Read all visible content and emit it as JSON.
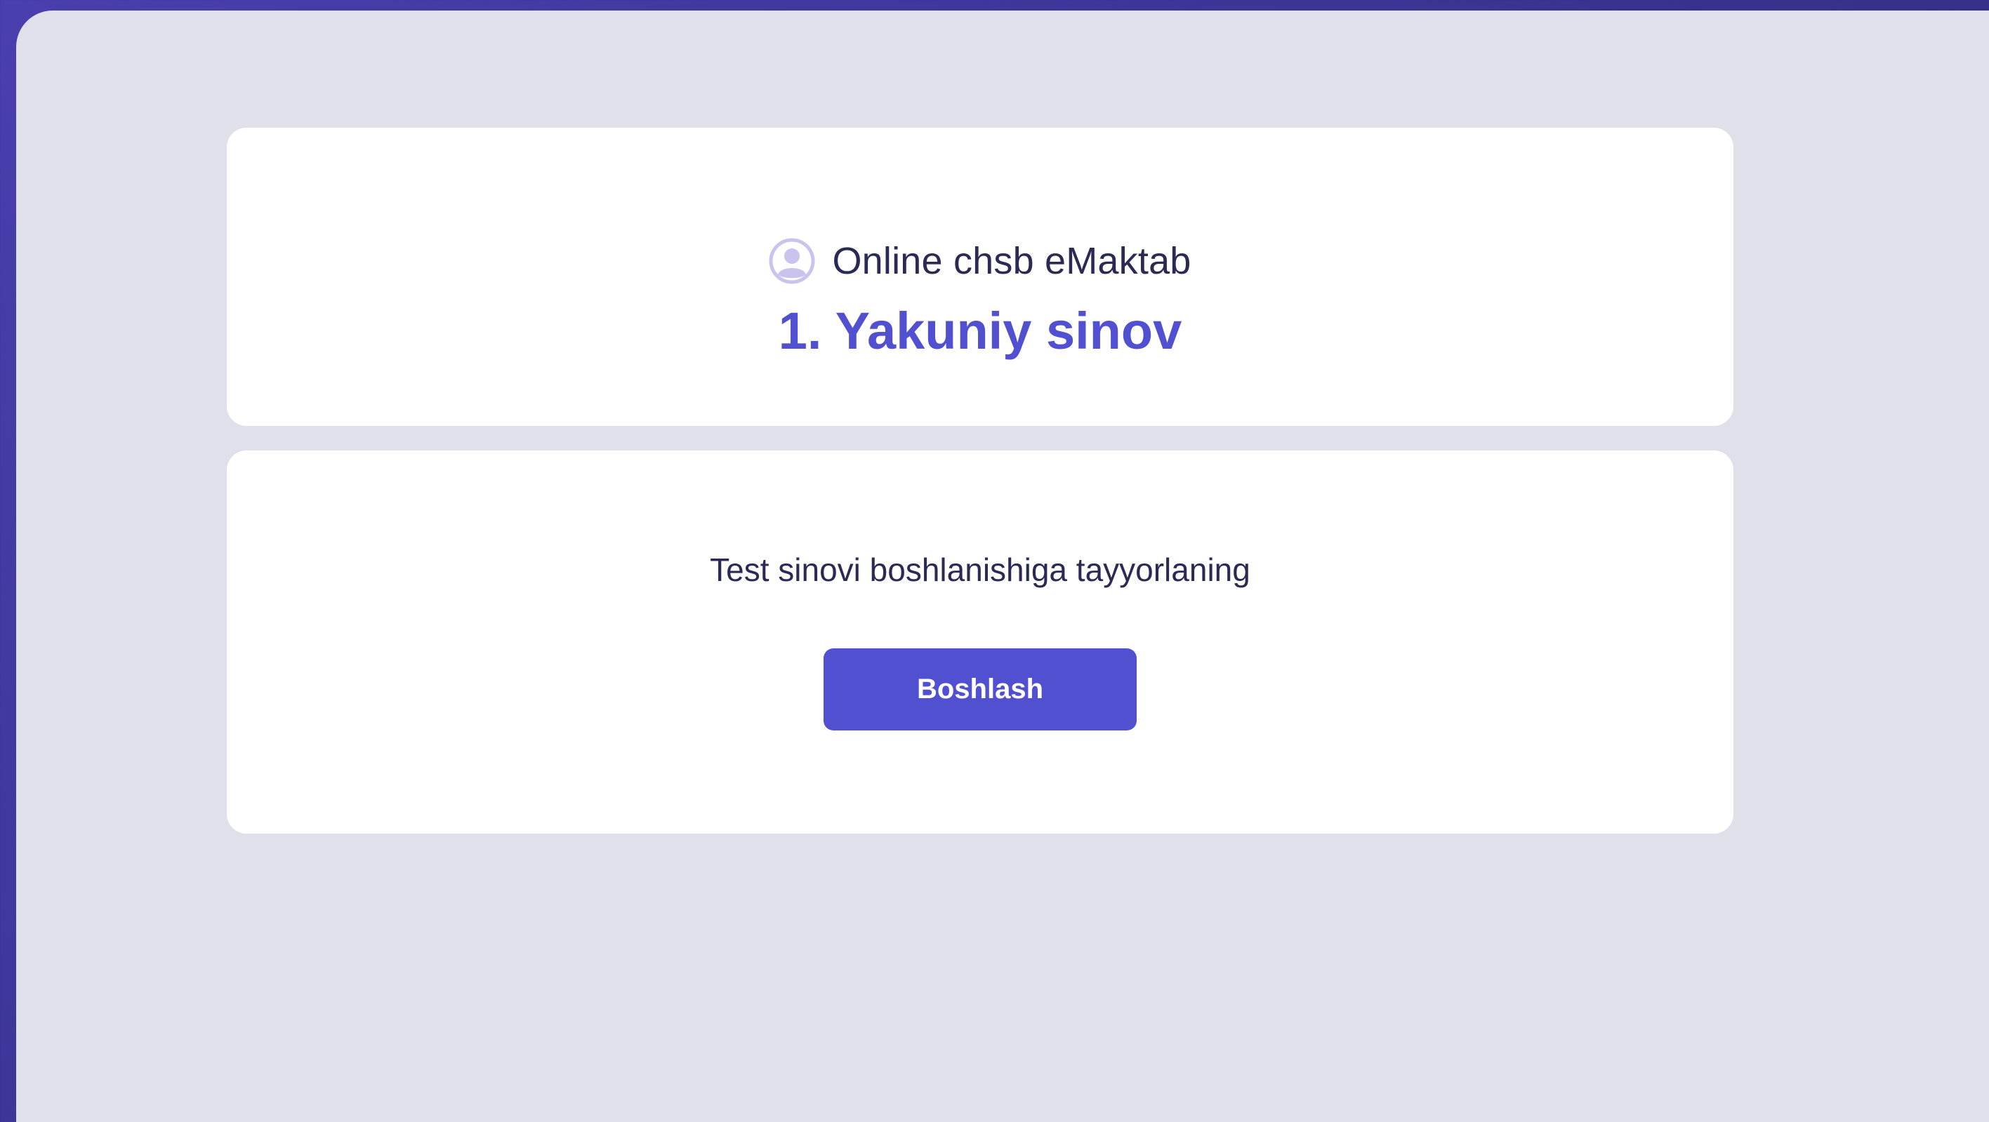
{
  "header": {
    "brand_name": "Online chsb eMaktab",
    "brand_icon": "user-avatar-icon",
    "test_title": "1. Yakuniy sinov"
  },
  "body": {
    "prepare_text": "Test sinovi boshlanishiga tayyorlaning",
    "start_button_label": "Boshlash"
  },
  "colors": {
    "accent": "#5150d1",
    "page_background": "#e0e0eb",
    "frame_background": "#3c3596",
    "text_dark": "#2a2a55",
    "icon_tint": "#c9c3ee"
  }
}
